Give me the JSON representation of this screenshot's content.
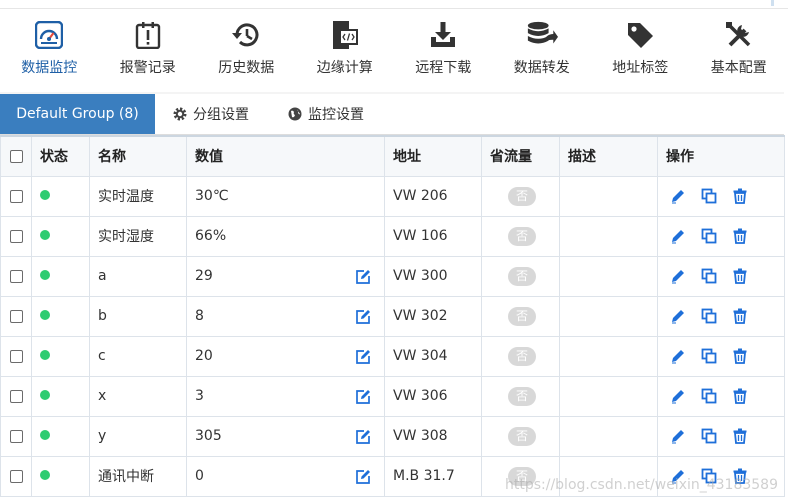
{
  "toolbar": [
    {
      "label": "数据监控",
      "icon": "dashboard-monitor-icon",
      "active": true
    },
    {
      "label": "报警记录",
      "icon": "alarm-clipboard-icon"
    },
    {
      "label": "历史数据",
      "icon": "history-clock-icon"
    },
    {
      "label": "边缘计算",
      "icon": "code-file-icon"
    },
    {
      "label": "远程下载",
      "icon": "download-tray-icon"
    },
    {
      "label": "数据转发",
      "icon": "database-forward-icon"
    },
    {
      "label": "地址标签",
      "icon": "tag-icon"
    },
    {
      "label": "基本配置",
      "icon": "tools-icon"
    }
  ],
  "tabs": {
    "group": "Default Group (8)",
    "group_settings": "分组设置",
    "monitor_settings": "监控设置"
  },
  "table": {
    "headers": {
      "status": "状态",
      "name": "名称",
      "value": "数值",
      "address": "地址",
      "saving": "省流量",
      "desc": "描述",
      "ops": "操作"
    },
    "rows": [
      {
        "name": "实时温度",
        "value": "30℃",
        "address": "VW 206",
        "saving": "否",
        "desc": "",
        "editable": false
      },
      {
        "name": "实时湿度",
        "value": "66%",
        "address": "VW 106",
        "saving": "否",
        "desc": "",
        "editable": false
      },
      {
        "name": "a",
        "value": "29",
        "address": "VW 300",
        "saving": "否",
        "desc": "",
        "editable": true
      },
      {
        "name": "b",
        "value": "8",
        "address": "VW 302",
        "saving": "否",
        "desc": "",
        "editable": true
      },
      {
        "name": "c",
        "value": "20",
        "address": "VW 304",
        "saving": "否",
        "desc": "",
        "editable": true
      },
      {
        "name": "x",
        "value": "3",
        "address": "VW 306",
        "saving": "否",
        "desc": "",
        "editable": true
      },
      {
        "name": "y",
        "value": "305",
        "address": "VW 308",
        "saving": "否",
        "desc": "",
        "editable": true
      },
      {
        "name": "通讯中断",
        "value": "0",
        "address": "M.B 31.7",
        "saving": "否",
        "desc": "",
        "editable": true
      }
    ]
  },
  "watermark": "https://blog.csdn.net/weixin_43183589",
  "colors": {
    "accent": "#3a7ebf",
    "status_online": "#2ecc71",
    "icon_blue": "#1e6fd9"
  }
}
